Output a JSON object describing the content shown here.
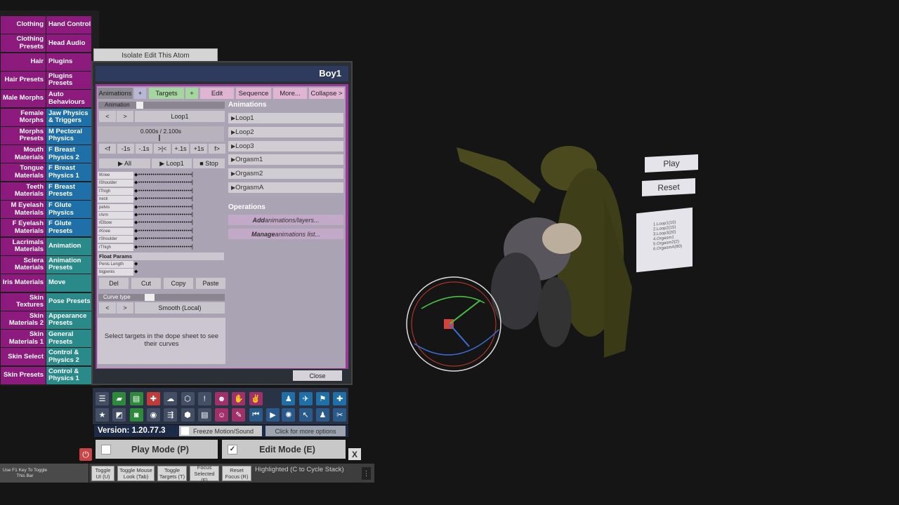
{
  "left_tabs": [
    [
      "Clothing",
      "Hand Control"
    ],
    [
      "Clothing Presets",
      "Head Audio"
    ],
    [
      "Hair",
      "Plugins"
    ],
    [
      "Hair Presets",
      "Plugins Presets"
    ],
    [
      "Male Morphs",
      "Auto Behaviours"
    ],
    [
      "Female Morphs",
      "Jaw Physics & Triggers"
    ],
    [
      "Morphs Presets",
      "M Pectoral Physics"
    ],
    [
      "Mouth Materials",
      "F Breast Physics 2"
    ],
    [
      "Tongue Materials",
      "F Breast Physics 1"
    ],
    [
      "Teeth Materials",
      "F Breast Presets"
    ],
    [
      "M Eyelash Materials",
      "F Glute Physics"
    ],
    [
      "F Eyelash Materials",
      "F Glute Presets"
    ],
    [
      "Lacrimals Materials",
      "Animation"
    ],
    [
      "Sclera Materials",
      "Animation Presets"
    ],
    [
      "Iris Materials",
      "Move"
    ],
    [
      "Skin Textures",
      "Pose Presets"
    ],
    [
      "Skin Materials 2",
      "Appearance Presets"
    ],
    [
      "Skin Materials 1",
      "General Presets"
    ],
    [
      "Skin Select",
      "Control & Physics 2"
    ],
    [
      "Skin Presets",
      "Control & Physics 1"
    ]
  ],
  "isolate_label": "Isolate Edit This Atom",
  "window_title": "Boy1",
  "tab_bar": {
    "animations": "Animations",
    "plus1": "+",
    "targets": "Targets",
    "plus2": "+",
    "edit": "Edit",
    "sequence": "Sequence",
    "more": "More...",
    "collapse": "Collapse >"
  },
  "animation_label": "Animation",
  "prev": "<",
  "next": ">",
  "current_anim": "Loop1",
  "time_readout": "0.000s / 2.100s",
  "step_buttons": [
    "<f",
    "-1s",
    "-.1s",
    ">|<",
    "+.1s",
    "+1s",
    "f>"
  ],
  "play_all": "▶ All",
  "play_loop": "▶ Loop1",
  "stop": "■ Stop",
  "targets": [
    "lKnee",
    "lShoulder",
    "lThigh",
    "neck",
    "pelvis",
    "rArm",
    "rElbow",
    "rKnee",
    "rShoulder",
    "rThigh"
  ],
  "float_params_header": "Float Params",
  "float_params": [
    "Penis Length",
    "bigpenis"
  ],
  "edit_buttons": [
    "Del",
    "Cut",
    "Copy",
    "Paste"
  ],
  "curve_type_label": "Curve type",
  "curve_value": "Smooth (Local)",
  "curve_hint": "Select targets in the dope sheet to see their curves",
  "animations_header": "Animations",
  "animations": [
    "Loop1",
    "Loop2",
    "Loop3",
    "Orgasm1",
    "Orgasm2",
    "OrgasmA"
  ],
  "operations_header": "Operations",
  "op_add": {
    "bold": "Add",
    "rest": " animations/layers..."
  },
  "op_manage": {
    "bold": "Manage",
    "rest": " animations list..."
  },
  "close_label": "Close",
  "version": "Version: 1.20.77.3",
  "freeze_label": "Freeze Motion/Sound",
  "more_options": "Click for more options",
  "play_mode": "Play Mode (P)",
  "edit_mode": "Edit Mode (E)",
  "edit_check": "✓",
  "x_label": "X",
  "f1_hint": "Use F1 Key To Toggle This Bar",
  "bottom_buttons": [
    "Toggle UI (U)",
    "Toggle Mouse Look (Tab)",
    "Toggle Targets (T)",
    "Focus Selected (F)",
    "Reset Focus (R)"
  ],
  "highlighted": "Highlighted (C to Cycle Stack)",
  "scene_play": "Play",
  "scene_reset": "Reset",
  "scene_list": [
    "1.Loop1(10)",
    "2.Loop2(15)",
    "3.Loop3(20)",
    "4.Orgasm1",
    "5.Orgasm2(2)",
    "6.OrgasmA(80)"
  ],
  "colors": {
    "magenta": "#8d1a7d",
    "teal": "#2a8a8a",
    "blue": "#1f6fa8",
    "purple": "#9a3a98",
    "toolbar": "#2a3246"
  }
}
